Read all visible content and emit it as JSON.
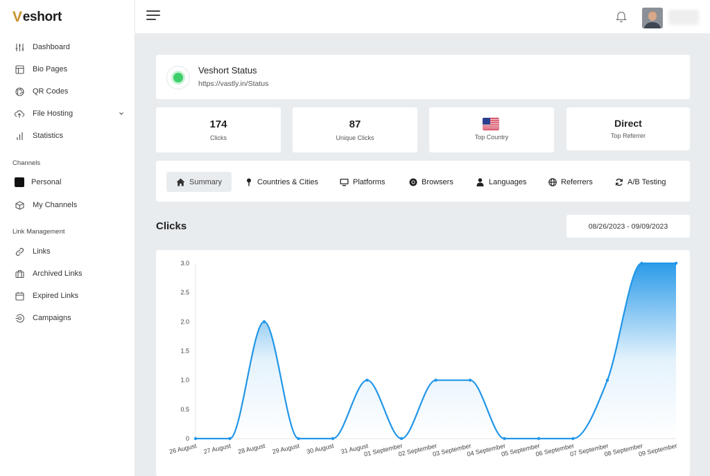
{
  "app": {
    "logo_v": "V",
    "logo_rest": "eshort"
  },
  "sidebar": {
    "items": [
      {
        "label": "Dashboard",
        "icon": "sliders-icon"
      },
      {
        "label": "Bio Pages",
        "icon": "layout-icon"
      },
      {
        "label": "QR Codes",
        "icon": "aperture-icon"
      },
      {
        "label": "File Hosting",
        "icon": "upload-cloud-icon",
        "expandable": true
      },
      {
        "label": "Statistics",
        "icon": "bar-chart-icon"
      }
    ],
    "channels_label": "Channels",
    "channels": [
      {
        "label": "Personal",
        "color": "#111111"
      },
      {
        "label": "My Channels",
        "icon": "box-icon"
      }
    ],
    "link_management_label": "Link Management",
    "links": [
      {
        "label": "Links",
        "icon": "link-icon"
      },
      {
        "label": "Archived Links",
        "icon": "briefcase-icon"
      },
      {
        "label": "Expired Links",
        "icon": "calendar-icon"
      },
      {
        "label": "Campaigns",
        "icon": "target-icon"
      }
    ]
  },
  "status": {
    "title": "Veshort Status",
    "url": "https://vastly.in/Status",
    "color": "#3ecf6b"
  },
  "stats": [
    {
      "value": "174",
      "label": "Clicks"
    },
    {
      "value": "87",
      "label": "Unique Clicks"
    },
    {
      "value": "",
      "label": "Top Country",
      "icon": "us-flag-icon"
    },
    {
      "value": "Direct",
      "label": "Top Referrer"
    }
  ],
  "tabs": [
    {
      "label": "Summary",
      "icon": "home-icon",
      "active": true
    },
    {
      "label": "Countries & Cities",
      "icon": "map-pin-icon"
    },
    {
      "label": "Platforms",
      "icon": "monitor-icon"
    },
    {
      "label": "Browsers",
      "icon": "chrome-icon"
    },
    {
      "label": "Languages",
      "icon": "user-icon"
    },
    {
      "label": "Referrers",
      "icon": "globe-icon"
    },
    {
      "label": "A/B Testing",
      "icon": "refresh-icon"
    }
  ],
  "clicks_section": {
    "heading": "Clicks",
    "date_range": "08/26/2023 - 09/09/2023"
  },
  "chart_data": {
    "type": "area",
    "categories": [
      "26 August",
      "27 August",
      "28 August",
      "29 August",
      "30 August",
      "31 August",
      "01 September",
      "02 September",
      "03 September",
      "04 September",
      "05 September",
      "06 September",
      "07 September",
      "08 September",
      "09 September"
    ],
    "values": [
      0,
      0,
      2,
      0,
      0,
      1,
      0,
      1,
      1,
      0,
      0,
      0,
      1,
      3,
      3
    ],
    "ylim": [
      0,
      3
    ],
    "yticks": [
      "0",
      "0.5",
      "1.0",
      "1.5",
      "2.0",
      "2.5",
      "3.0"
    ],
    "line_color": "#2196e8",
    "grid": false
  }
}
